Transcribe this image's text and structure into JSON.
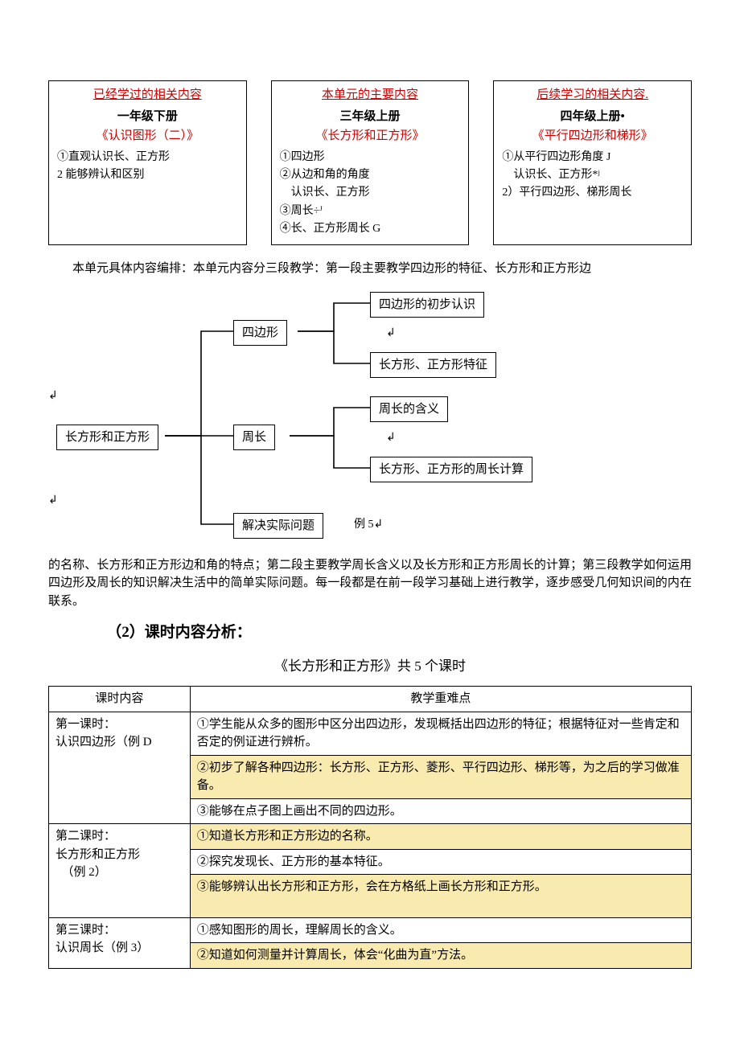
{
  "top": {
    "left": {
      "head": "已经学过的相关内容",
      "grade": "一年级下册",
      "book": "《认识图形（二）》",
      "items": [
        "①直观认识长、正方形",
        "2 能够辨认和区别"
      ]
    },
    "mid": {
      "head": "本单元的主要内容",
      "grade": "三年级上册",
      "book": "《长方形和正方形》",
      "items": [
        "①四边形",
        "②从边和角的角度",
        "　认识长、正方形",
        "③周长÷ᴶ",
        "④长、正方形周长 G"
      ]
    },
    "right": {
      "head": "后续学习的相关内容.",
      "grade": "四年级上册•",
      "book": "《平行四边形和梯形》",
      "items": [
        "①从平行四边形角度 J",
        "　认识长、正方形*ʲ",
        "2）平行四边形、梯形周长"
      ]
    }
  },
  "para1": "本单元具体内容编排：本单元内容分三段教学：第一段主要教学四边形的特征、长方形和正方形边",
  "diagram": {
    "root": "长方形和正方形",
    "n1": "四边形",
    "n2": "周长",
    "n3": "解决实际问题",
    "leaf1": "四边形的初步认识",
    "leaf2": "长方形、正方形特征",
    "leaf3": "周长的含义",
    "leaf4": "长方形、正方形的周长计算",
    "note3": "例 5↲",
    "arrow1": "↲",
    "arrow2": "↲",
    "arrow3": "↲",
    "arrow4": "↲"
  },
  "para2": "的名称、长方形和正方形边和角的特点；第二段主要教学周长含义以及长方形和正方形周长的计算；第三段教学如何运用四边形及周长的知识解决生活中的简单实际问题。每一段都是在前一段学习基础上进行教学，逐步感受几何知识间的内在联系。",
  "section_h": "（2）课时内容分析：",
  "table_title": "《长方形和正方形》共 5 个课时",
  "table": {
    "head": [
      "课时内容",
      "教学重难点"
    ],
    "rows": [
      {
        "lesson": [
          "第一课时：",
          "",
          "认识四边形（例 D"
        ],
        "points": [
          "①学生能从众多的图形中区分出四边形，发现概括出四边形的特征；根据特征对一些肯定和否定的例证进行辨析。",
          "②初步了解各种四边形：长方形、正方形、菱形、平行四边形、梯形等，为之后的学习做准备。",
          "③能够在点子图上画出不同的四边形。"
        ],
        "yellow": [
          false,
          true,
          false
        ]
      },
      {
        "lesson": [
          "第二课时：",
          "长方形和正方形",
          "　（例 2）"
        ],
        "points": [
          "①知道长方形和正方形边的名称。",
          "②探究发现长、正方形的基本特征。",
          "③能够辨认出长方形和正方形，会在方格纸上画长方形和正方形。"
        ],
        "yellow": [
          true,
          false,
          true
        ]
      },
      {
        "lesson": [
          "第三课时：",
          "认识周长（例 3）"
        ],
        "points": [
          "①感知图形的周长，理解周长的含义。",
          "②知道如何测量并计算周长，体会“化曲为直”方法。"
        ],
        "yellow": [
          false,
          true
        ]
      }
    ]
  }
}
